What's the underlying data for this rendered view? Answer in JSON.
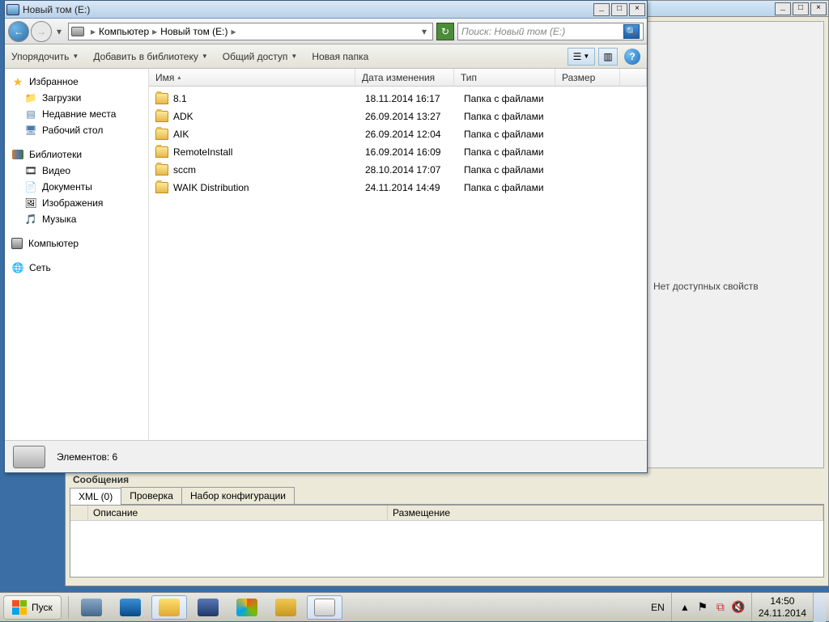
{
  "explorer": {
    "title": "Новый том (E:)",
    "breadcrumb": {
      "root": "Компьютер",
      "current": "Новый том (E:)"
    },
    "search_placeholder": "Поиск: Новый том (E:)",
    "toolbar": {
      "organize": "Упорядочить",
      "addlib": "Добавить в библиотеку",
      "share": "Общий доступ",
      "newfolder": "Новая папка"
    },
    "sidebar": {
      "favorites": "Избранное",
      "downloads": "Загрузки",
      "recent": "Недавние места",
      "desktop": "Рабочий стол",
      "libraries": "Библиотеки",
      "videos": "Видео",
      "documents": "Документы",
      "pictures": "Изображения",
      "music": "Музыка",
      "computer": "Компьютер",
      "network": "Сеть"
    },
    "columns": {
      "name": "Имя",
      "date": "Дата изменения",
      "type": "Тип",
      "size": "Размер"
    },
    "files": [
      {
        "name": "8.1",
        "date": "18.11.2014 16:17",
        "type": "Папка с файлами"
      },
      {
        "name": "ADK",
        "date": "26.09.2014 13:27",
        "type": "Папка с файлами"
      },
      {
        "name": "AIK",
        "date": "26.09.2014 12:04",
        "type": "Папка с файлами"
      },
      {
        "name": "RemoteInstall",
        "date": "16.09.2014 16:09",
        "type": "Папка с файлами"
      },
      {
        "name": "sccm",
        "date": "28.10.2014 17:07",
        "type": "Папка с файлами"
      },
      {
        "name": "WAIK Distribution",
        "date": "24.11.2014 14:49",
        "type": "Папка с файлами"
      }
    ],
    "status": "Элементов: 6"
  },
  "bgwindow": {
    "noprops": "Нет доступных свойств",
    "messages_title": "Сообщения",
    "tabs": {
      "xml": "XML (0)",
      "check": "Проверка",
      "configset": "Набор конфигурации"
    },
    "cols": {
      "desc": "Описание",
      "loc": "Размещение"
    }
  },
  "taskbar": {
    "start": "Пуск",
    "lang": "EN",
    "time": "14:50",
    "date": "24.11.2014"
  }
}
